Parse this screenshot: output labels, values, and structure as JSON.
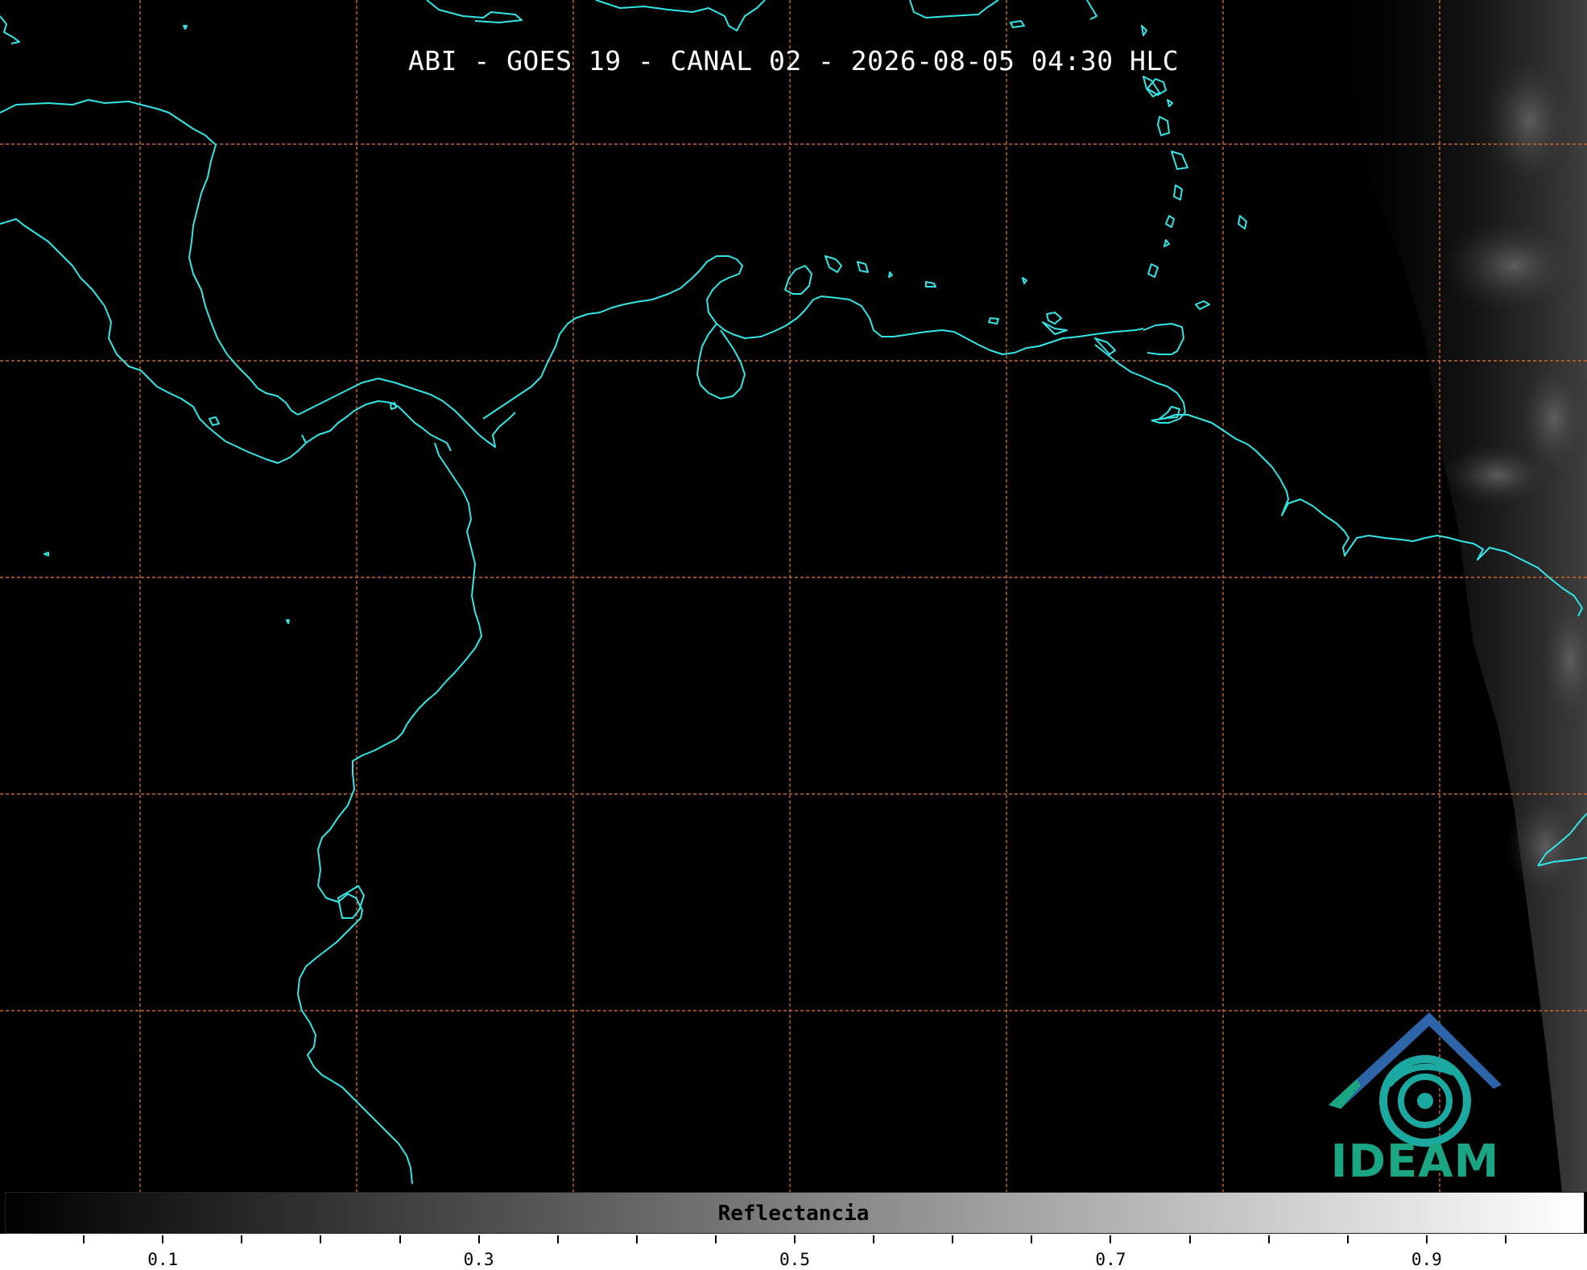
{
  "title": "ABI - GOES 19 - CANAL 02 - 2026-08-05 04:30 HLC",
  "colorbar": {
    "label": "Reflectancia",
    "range": [
      0.0,
      1.0
    ],
    "colormap": "grayscale",
    "tick_labels": [
      "0.1",
      "0.3",
      "0.5",
      "0.7",
      "0.9"
    ]
  },
  "logo": {
    "text": "IDEAM",
    "colors": {
      "text": "#1aa683",
      "roof": "#2e64a8",
      "swirl": "#1aa8a0"
    }
  },
  "map": {
    "background": "#000000",
    "coastline_color": "#33e6e6",
    "gridline_color": "#c8692c",
    "gridline_style": "dashed"
  }
}
